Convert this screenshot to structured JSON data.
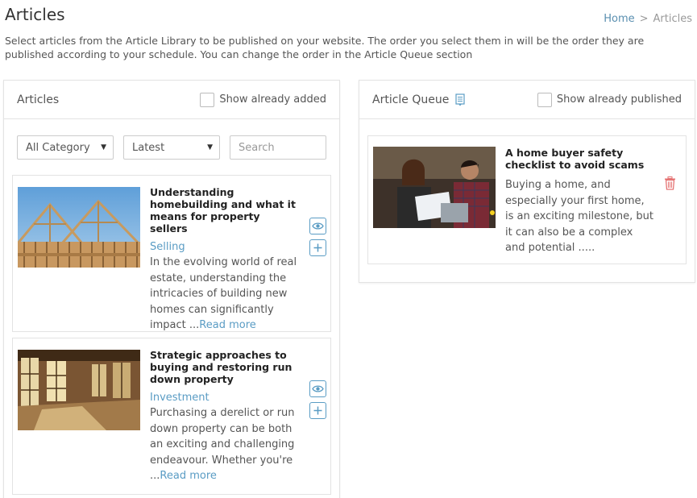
{
  "page": {
    "title": "Articles",
    "breadcrumb": {
      "home": "Home",
      "separator": ">",
      "current": "Articles"
    },
    "intro": "Select articles from the Article Library to be published on your website. The order you select them in will be the order they are published according to your schedule. You can change the order in the Article Queue section"
  },
  "articles_panel": {
    "title": "Articles",
    "show_added_label": "Show already added",
    "category_select": "All Category",
    "sort_select": "Latest",
    "search_placeholder": "Search",
    "items": [
      {
        "title": "Understanding homebuilding and what it means for property sellers",
        "category": "Selling",
        "excerpt": "In the evolving world of real estate, understanding the intricacies of building new homes can significantly impact ...",
        "read_more": "Read more"
      },
      {
        "title": "Strategic approaches to buying and restoring run down property",
        "category": "Investment",
        "excerpt": "Purchasing a derelict or run down property can be both an exciting and challenging endeavour. Whether you're ...",
        "read_more": "Read more"
      }
    ]
  },
  "queue_panel": {
    "title": "Article Queue",
    "show_published_label": "Show already published",
    "items": [
      {
        "title": "A home buyer safety checklist to avoid scams",
        "excerpt": "Buying a home, and especially your first home, is an exciting milestone, but it can also be a complex and potential ....."
      }
    ]
  },
  "colors": {
    "accent": "#5a9cc4",
    "delete": "#e57373"
  }
}
